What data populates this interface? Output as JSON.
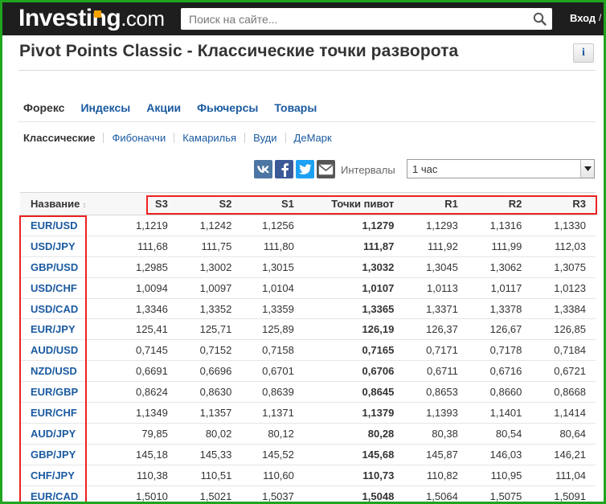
{
  "header": {
    "logo_main": "Investing",
    "logo_suffix": ".com",
    "search_placeholder": "Поиск на сайте...",
    "login_label": "Вход",
    "login_chevron": "/"
  },
  "page": {
    "title": "Pivot Points Classic - Классические точки разворота",
    "info_label": "i"
  },
  "tabs": [
    {
      "label": "Форекс",
      "active": true
    },
    {
      "label": "Индексы"
    },
    {
      "label": "Акции"
    },
    {
      "label": "Фьючерсы"
    },
    {
      "label": "Товары"
    }
  ],
  "subtabs": [
    {
      "label": "Классические",
      "active": true
    },
    {
      "label": "Фибоначчи"
    },
    {
      "label": "Камарилья"
    },
    {
      "label": "Вуди"
    },
    {
      "label": "ДеМарк"
    }
  ],
  "share_icons": [
    "vk-icon",
    "facebook-icon",
    "twitter-icon",
    "mail-icon"
  ],
  "intervals": {
    "label": "Интервалы",
    "selected": "1 час"
  },
  "table": {
    "columns": [
      "Название",
      "S3",
      "S2",
      "S1",
      "Точки пивот",
      "R1",
      "R2",
      "R3"
    ],
    "rows": [
      [
        "EUR/USD",
        "1,1219",
        "1,1242",
        "1,1256",
        "1,1279",
        "1,1293",
        "1,1316",
        "1,1330"
      ],
      [
        "USD/JPY",
        "111,68",
        "111,75",
        "111,80",
        "111,87",
        "111,92",
        "111,99",
        "112,03"
      ],
      [
        "GBP/USD",
        "1,2985",
        "1,3002",
        "1,3015",
        "1,3032",
        "1,3045",
        "1,3062",
        "1,3075"
      ],
      [
        "USD/CHF",
        "1,0094",
        "1,0097",
        "1,0104",
        "1,0107",
        "1,0113",
        "1,0117",
        "1,0123"
      ],
      [
        "USD/CAD",
        "1,3346",
        "1,3352",
        "1,3359",
        "1,3365",
        "1,3371",
        "1,3378",
        "1,3384"
      ],
      [
        "EUR/JPY",
        "125,41",
        "125,71",
        "125,89",
        "126,19",
        "126,37",
        "126,67",
        "126,85"
      ],
      [
        "AUD/USD",
        "0,7145",
        "0,7152",
        "0,7158",
        "0,7165",
        "0,7171",
        "0,7178",
        "0,7184"
      ],
      [
        "NZD/USD",
        "0,6691",
        "0,6696",
        "0,6701",
        "0,6706",
        "0,6711",
        "0,6716",
        "0,6721"
      ],
      [
        "EUR/GBP",
        "0,8624",
        "0,8630",
        "0,8639",
        "0,8645",
        "0,8653",
        "0,8660",
        "0,8668"
      ],
      [
        "EUR/CHF",
        "1,1349",
        "1,1357",
        "1,1371",
        "1,1379",
        "1,1393",
        "1,1401",
        "1,1414"
      ],
      [
        "AUD/JPY",
        "79,85",
        "80,02",
        "80,12",
        "80,28",
        "80,38",
        "80,54",
        "80,64"
      ],
      [
        "GBP/JPY",
        "145,18",
        "145,33",
        "145,52",
        "145,68",
        "145,87",
        "146,03",
        "146,21"
      ],
      [
        "CHF/JPY",
        "110,38",
        "110,51",
        "110,60",
        "110,73",
        "110,82",
        "110,95",
        "111,04"
      ],
      [
        "EUR/CAD",
        "1,5010",
        "1,5021",
        "1,5037",
        "1,5048",
        "1,5064",
        "1,5075",
        "1,5091"
      ]
    ]
  },
  "colors": {
    "frame": "#1fa51f",
    "topbar": "#1e1e1e",
    "link": "#1a5aa0",
    "highlight_box": "#e22222",
    "logo_dot": "#f7a400"
  }
}
